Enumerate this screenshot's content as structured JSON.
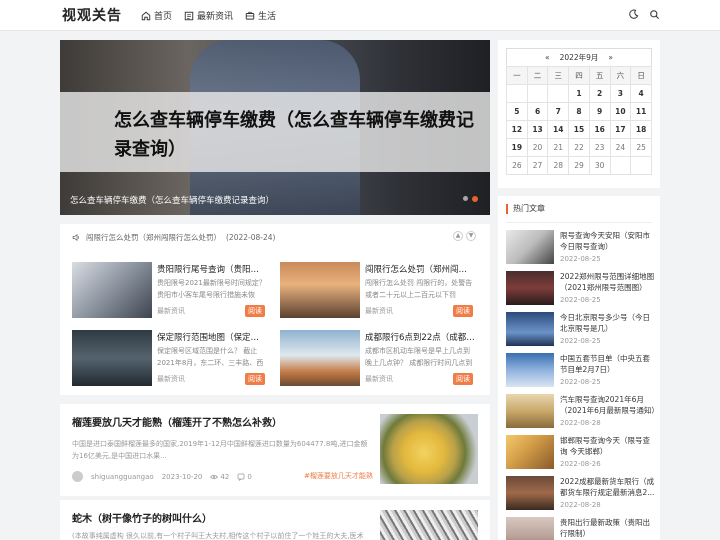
{
  "header": {
    "logo": "视观关告",
    "nav": [
      "首页",
      "最新资讯",
      "生活"
    ]
  },
  "slider": {
    "big_title": "怎么查车辆停车缴费（怎么查车辆停车缴费记录查询）",
    "caption": "怎么查车辆停车缴费（怎么查车辆停车缴费记录查询）"
  },
  "notice": {
    "text": "闯限行怎么处罚（郑州闯限行怎么处罚）",
    "date": "(2022-08-24)"
  },
  "cards": [
    {
      "title": "贵阳限行尾号查询（贵阳市限行尾号查询）",
      "desc": "贵阳限号2021最新限号时间规定？ 贵阳市小客车尾号限行措施未恢复，...",
      "foot": "最新资讯",
      "tag": "阅读"
    },
    {
      "title": "闯限行怎么处罚（郑州闯限行怎么处罚）",
      "desc": "闯限行怎么处罚 闯限行的，处警告或者二十元以上二百元以下罚款，...",
      "foot": "最新资讯",
      "tag": "阅读"
    },
    {
      "title": "保定限行范围地图（保定限行范围地图2021）",
      "desc": "保定限号区域范围是什么？ 截止2021年8月，东二环、三丰路、西二...",
      "foot": "最新资讯",
      "tag": "阅读"
    },
    {
      "title": "成都限行6点到22点（成都限行时间）",
      "desc": "成都市区机动车限号是早上几点到晚上几点钟？ 成都限行时间几点到几...",
      "foot": "最新资讯",
      "tag": "阅读"
    }
  ],
  "articles": [
    {
      "title": "榴莲要放几天才能熟（榴莲开了不熟怎么补救）",
      "desc": "中国是进口泰国鲜榴莲最多的国家,2019年1-12月中国鲜榴莲进口数量为604477.8吨,进口金额为16亿美元,是中国进口水果...",
      "author": "shiguangguangao",
      "date": "2023-10-20",
      "views": "42",
      "comments": "0",
      "tag": "#榴莲要放几天才能熟"
    },
    {
      "title": "蛇木（树干像竹子的树叫什么）",
      "desc": "(本故事纯属虚构 很久以前,有一个村子叫王大夫村,相传这个村子以前住了一个姓王的大夫,医术十...",
      "author": "",
      "date": "",
      "views": "",
      "comments": "",
      "tag": ""
    }
  ],
  "calendar": {
    "month": "2022年9月",
    "prev": "«",
    "next": "»",
    "weekdays": [
      "一",
      "二",
      "三",
      "四",
      "五",
      "六",
      "日"
    ],
    "rows": [
      [
        "",
        "",
        "",
        "1",
        "2",
        "3",
        "4"
      ],
      [
        "5",
        "6",
        "7",
        "8",
        "9",
        "10",
        "11"
      ],
      [
        "12",
        "13",
        "14",
        "15",
        "16",
        "17",
        "18"
      ],
      [
        "19",
        "20",
        "21",
        "22",
        "23",
        "24",
        "25"
      ],
      [
        "26",
        "27",
        "28",
        "29",
        "30",
        "",
        ""
      ]
    ]
  },
  "hot": {
    "title": "热门文章",
    "items": [
      {
        "title": "限号查询今天安阳（安阳市今日限号查询）",
        "date": "2022-08-25"
      },
      {
        "title": "2022郑州限号范围详细地图（2021郑州限号范围图）",
        "date": "2022-08-25"
      },
      {
        "title": "今日北京限号多少号（今日北京限号是几）",
        "date": "2022-08-25"
      },
      {
        "title": "中国五套节目单（中央五套节目单2月7日）",
        "date": "2022-08-25"
      },
      {
        "title": "汽车限号查询2021年6月（2021年6月最新限号通知）",
        "date": "2022-08-28"
      },
      {
        "title": "邯郸限号查询今天（限号查询 今天邯郸）",
        "date": "2022-08-26"
      },
      {
        "title": "2022成都最新货车限行（成都货车限行规定最新消息2...",
        "date": "2022-08-28"
      },
      {
        "title": "贵阳出行最新政策（贵阳出行限制）",
        "date": ""
      }
    ]
  }
}
